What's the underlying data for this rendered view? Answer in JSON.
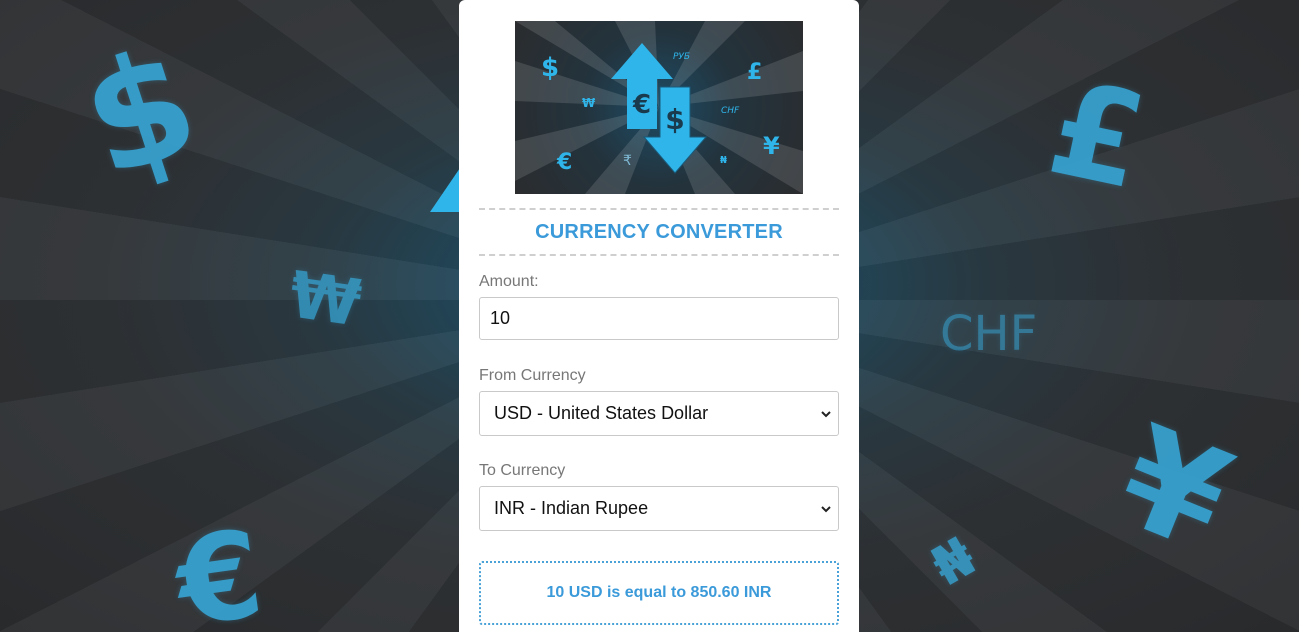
{
  "background": {
    "glyphs": [
      "$",
      "₩",
      "€",
      "£",
      "CHF",
      "¥",
      "₦"
    ]
  },
  "hero": {
    "glyphs": [
      "$",
      "РУБ",
      "£",
      "₩",
      "CHF",
      "€",
      "₹",
      "₦",
      "¥",
      "€",
      "$"
    ]
  },
  "title": "CURRENCY CONVERTER",
  "amount": {
    "label": "Amount:",
    "value": "10"
  },
  "from": {
    "label": "From Currency",
    "selected": "USD - United States Dollar"
  },
  "to": {
    "label": "To Currency",
    "selected": "INR - Indian Rupee"
  },
  "result": "10 USD is equal to 850.60 INR",
  "colors": {
    "accent": "#3b9ad9",
    "glyph": "#37a6d6"
  }
}
